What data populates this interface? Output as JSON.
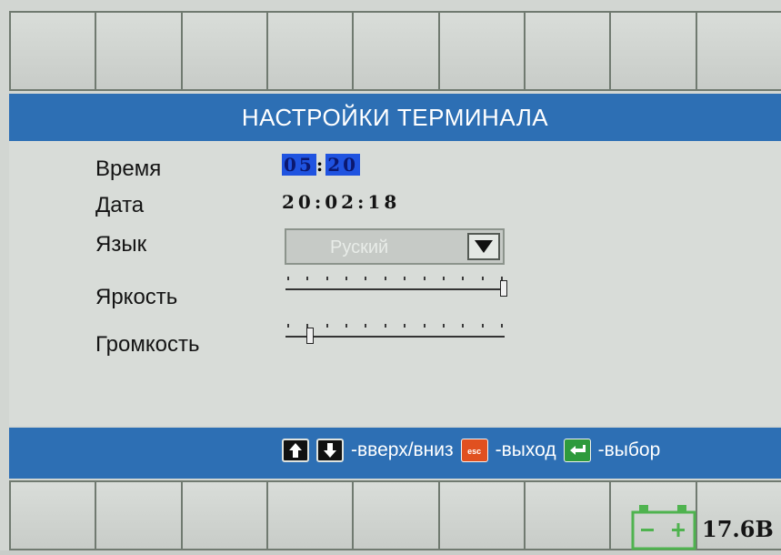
{
  "header": {
    "title": "НАСТРОЙКИ ТЕРМИНАЛА"
  },
  "settings": {
    "time": {
      "label": "Время",
      "hours": "05",
      "minutes": "20"
    },
    "date": {
      "label": "Дата",
      "value": "20:02:18"
    },
    "language": {
      "label": "Язык",
      "selected": "Руский"
    },
    "brightness": {
      "label": "Яркость",
      "level": 1.0
    },
    "volume": {
      "label": "Громкость",
      "level": 0.1
    }
  },
  "hints": {
    "updown": "-вверх/вниз",
    "esc_key": "esc",
    "exit": "-выход",
    "select": "-выбор"
  },
  "status": {
    "battery_voltage": "17.6В"
  },
  "colors": {
    "accent": "#2d6fb4",
    "highlight": "#1f53e0",
    "esc": "#e05020",
    "enter": "#2e9a3c"
  }
}
